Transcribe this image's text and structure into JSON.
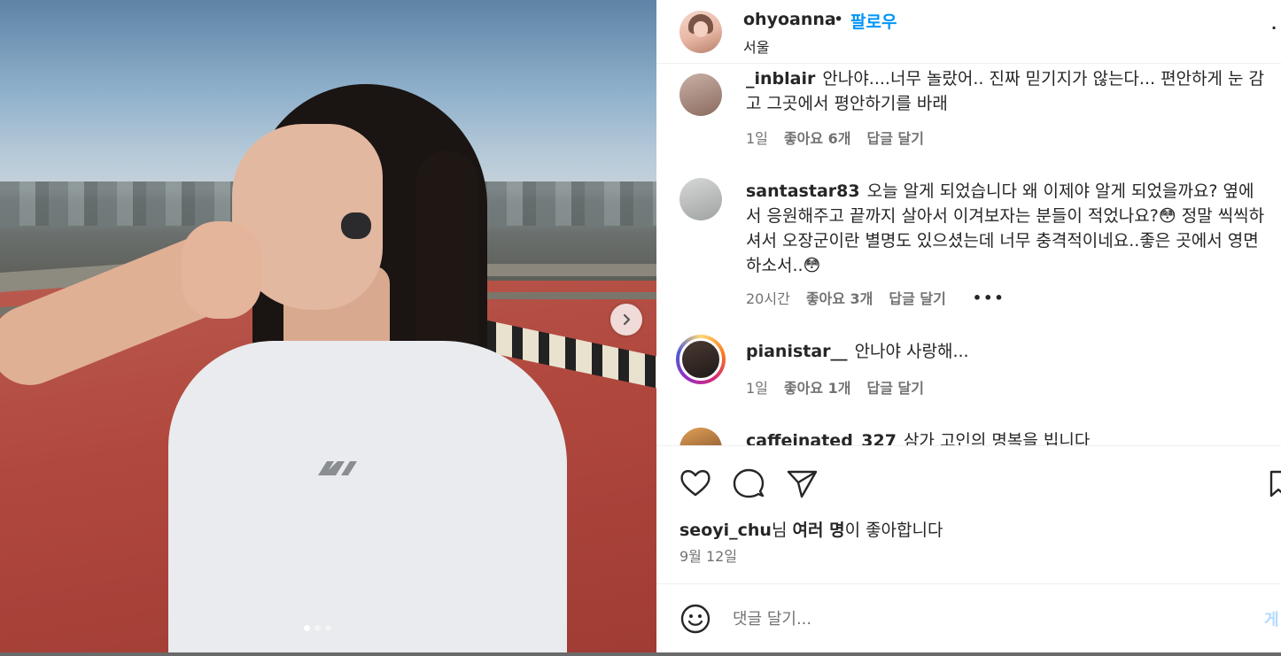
{
  "post": {
    "username": "ohyoanna",
    "separator": "•",
    "follow_label": "팔로우",
    "location": "서울",
    "more_label": "·"
  },
  "carousel": {
    "total_slides": 3,
    "active_slide": 1
  },
  "comments": [
    {
      "username": "_inblair",
      "text": "안나야....너무 놀랐어.. 진짜 믿기지가 않는다... 편안하게 눈 감고 그곳에서 평안하기를 바래",
      "time": "1일",
      "likes": "좋아요 6개",
      "reply": "답글 달기"
    },
    {
      "username": "santastar83",
      "text": "오늘 알게 되었습니다 왜 이제야 알게 되었을까요? 옆에서 응원해주고 끝까지 살아서 이겨보자는 분들이 적었나요?😳 정말 씩씩하셔서 오장군이란 별명도 있으셨는데 너무 충격적이네요..좋은 곳에서 영면하소서..😳",
      "time": "20시간",
      "likes": "좋아요 3개",
      "reply": "답글 달기",
      "more": "•••"
    },
    {
      "username": "pianistar__",
      "text": "안나야 사랑해...",
      "time": "1일",
      "likes": "좋아요 1개",
      "reply": "답글 달기"
    },
    {
      "username": "caffeinated_327",
      "text": "삼가 고인의 명복을 빕니다"
    }
  ],
  "likes_line": {
    "user": "seoyi_chu",
    "suffix_1": "님 ",
    "others": "여러 명",
    "suffix_2": "이 좋아합니다"
  },
  "date": "9월 12일",
  "comment_box": {
    "placeholder": "댓글 달기...",
    "post_label": "게"
  },
  "colors": {
    "accent": "#0095f6",
    "text": "#262626",
    "muted": "#737373"
  },
  "icons": [
    "chevron-right-icon",
    "heart-icon",
    "comment-icon",
    "share-icon",
    "bookmark-icon",
    "emoji-icon"
  ]
}
